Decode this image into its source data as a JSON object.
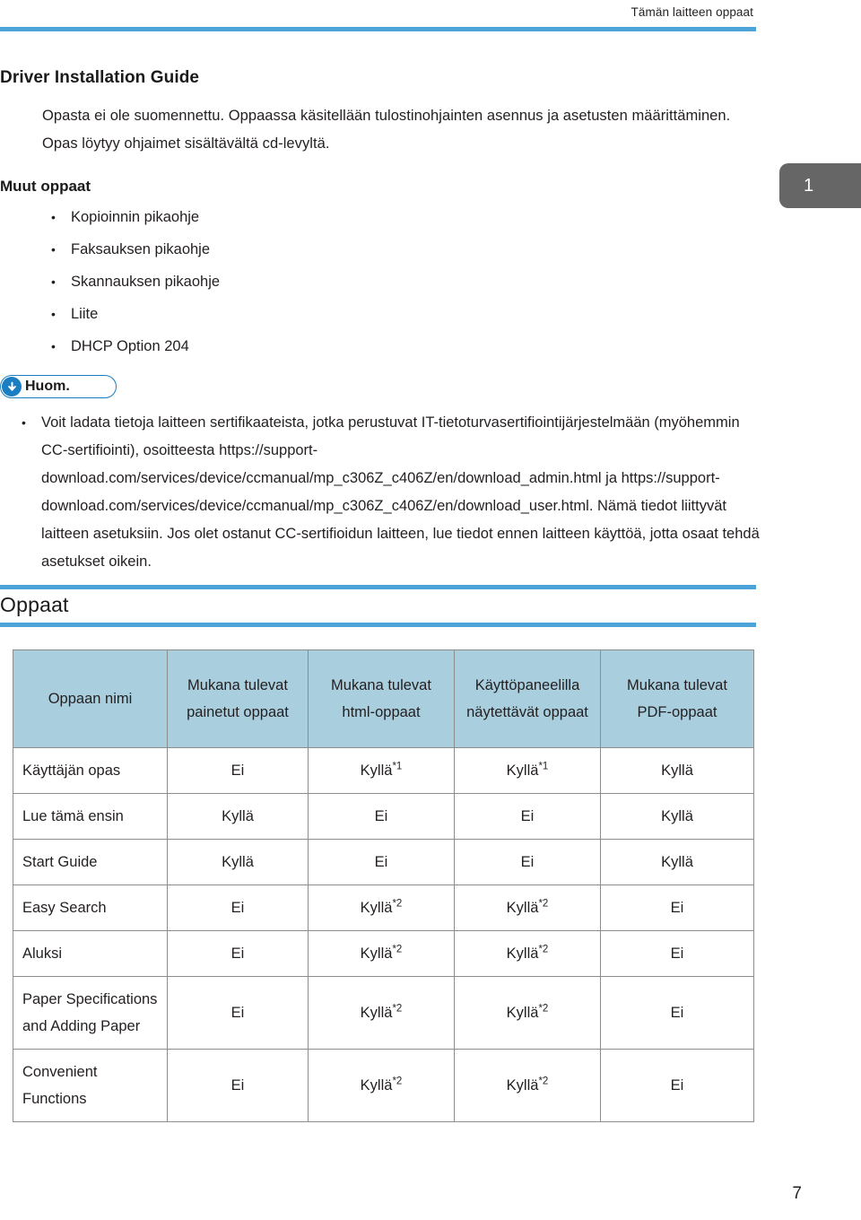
{
  "header": {
    "running_title": "Tämän laitteen oppaat",
    "rule_color": "#4ba3d8"
  },
  "chapter_tab": {
    "number": "1",
    "background": "#666666"
  },
  "driver_section": {
    "heading": "Driver Installation Guide",
    "paragraph": "Opasta ei ole suomennettu. Oppaassa käsitellään tulostinohjainten asennus ja asetusten määrittäminen. Opas löytyy ohjaimet sisältävältä cd-levyltä."
  },
  "other_guides": {
    "heading": "Muut oppaat",
    "items": [
      "Kopioinnin pikaohje",
      "Faksauksen pikaohje",
      "Skannauksen pikaohje",
      "Liite",
      "DHCP Option 204"
    ]
  },
  "note": {
    "badge_label": "Huom.",
    "badge_icon": "down-arrow-icon",
    "badge_color": "#1b7ec2",
    "bullets": [
      "Voit ladata tietoja laitteen sertifikaateista, jotka perustuvat IT-tietoturvasertifiointijärjestelmään (myöhemmin CC-sertifiointi), osoitteesta https://support-download.com/services/device/ccmanual/mp_c306Z_c406Z/en/download_admin.html ja https://support-download.com/services/device/ccmanual/mp_c306Z_c406Z/en/download_user.html. Nämä tiedot liittyvät laitteen asetuksiin. Jos olet ostanut CC-sertifioidun laitteen, lue tiedot ennen laitteen käyttöä, jotta osaat tehdä asetukset oikein."
    ]
  },
  "guides_section": {
    "title": "Oppaat",
    "table": {
      "header_background": "#a9cfdf",
      "columns": [
        "Oppaan nimi",
        "Mukana tulevat painetut oppaat",
        "Mukana tulevat html-oppaat",
        "Käyttöpaneelilla näytettävät oppaat",
        "Mukana tulevat PDF-oppaat"
      ],
      "rows": [
        {
          "name": "Käyttäjän opas",
          "printed": "Ei",
          "html": "Kyllä",
          "html_fn": "*1",
          "panel": "Kyllä",
          "panel_fn": "*1",
          "pdf": "Kyllä",
          "pdf_fn": ""
        },
        {
          "name": "Lue tämä ensin",
          "printed": "Kyllä",
          "html": "Ei",
          "html_fn": "",
          "panel": "Ei",
          "panel_fn": "",
          "pdf": "Kyllä",
          "pdf_fn": ""
        },
        {
          "name": "Start Guide",
          "printed": "Kyllä",
          "html": "Ei",
          "html_fn": "",
          "panel": "Ei",
          "panel_fn": "",
          "pdf": "Kyllä",
          "pdf_fn": ""
        },
        {
          "name": "Easy Search",
          "printed": "Ei",
          "html": "Kyllä",
          "html_fn": "*2",
          "panel": "Kyllä",
          "panel_fn": "*2",
          "pdf": "Ei",
          "pdf_fn": ""
        },
        {
          "name": "Aluksi",
          "printed": "Ei",
          "html": "Kyllä",
          "html_fn": "*2",
          "panel": "Kyllä",
          "panel_fn": "*2",
          "pdf": "Ei",
          "pdf_fn": ""
        },
        {
          "name": "Paper Specifications and Adding Paper",
          "printed": "Ei",
          "html": "Kyllä",
          "html_fn": "*2",
          "panel": "Kyllä",
          "panel_fn": "*2",
          "pdf": "Ei",
          "pdf_fn": ""
        },
        {
          "name": "Convenient Functions",
          "printed": "Ei",
          "html": "Kyllä",
          "html_fn": "*2",
          "panel": "Kyllä",
          "panel_fn": "*2",
          "pdf": "Ei",
          "pdf_fn": ""
        }
      ]
    }
  },
  "footer": {
    "page_number": "7"
  }
}
